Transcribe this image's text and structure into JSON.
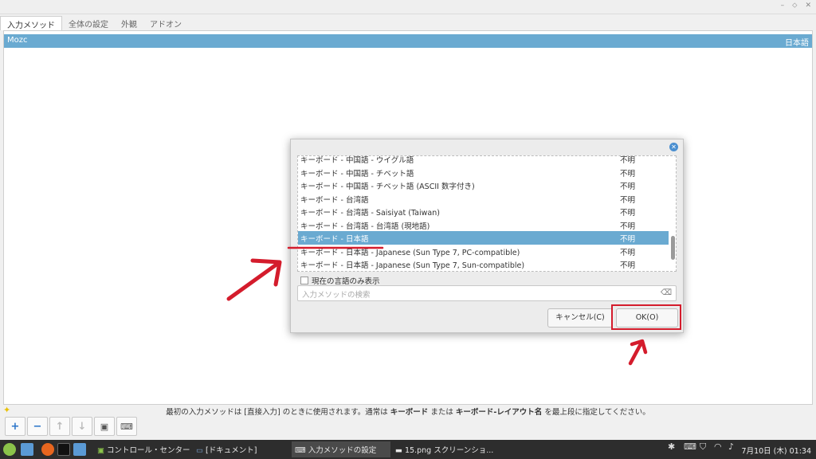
{
  "window": {
    "tabs": [
      "入力メソッド",
      "全体の設定",
      "外観",
      "アドオン"
    ],
    "im_row": {
      "name": "Mozc",
      "lang": "日本語"
    },
    "help_text": {
      "p1": "最初の入力メソッドは [直接入力] のときに使用されます。通常は ",
      "b1": "キーボード",
      "p2": " または ",
      "b2": "キーボード-レイアウト名",
      "p3": " を最上段に指定してください。"
    },
    "toolbar": [
      "add-icon",
      "remove-icon",
      "move-up-icon",
      "move-down-icon",
      "configure-icon",
      "keyboard-icon"
    ]
  },
  "dialog": {
    "items": [
      {
        "name": "キーボード - 中国語 - ウイグル語",
        "status": "不明"
      },
      {
        "name": "キーボード - 中国語 - チベット語",
        "status": "不明"
      },
      {
        "name": "キーボード - 中国語 - チベット語 (ASCII 数字付き)",
        "status": "不明"
      },
      {
        "name": "キーボード - 台湾語",
        "status": "不明"
      },
      {
        "name": "キーボード - 台湾語 - Saisiyat (Taiwan)",
        "status": "不明"
      },
      {
        "name": "キーボード - 台湾語 - 台湾語 (現地語)",
        "status": "不明"
      },
      {
        "name": "キーボード - 日本語",
        "status": "不明"
      },
      {
        "name": "キーボード - 日本語 - Japanese (Sun Type 7, PC-compatible)",
        "status": "不明"
      },
      {
        "name": "キーボード - 日本語 - Japanese (Sun Type 7, Sun-compatible)",
        "status": "不明"
      }
    ],
    "selected_index": 6,
    "current_lang_only_label": "現在の言語のみ表示",
    "search_placeholder": "入力メソッドの検索",
    "cancel_label": "キャンセル(C)",
    "ok_label": "OK(O)"
  },
  "taskbar": {
    "tasks": [
      "コントロール・センター",
      "[ドキュメント]",
      "入力メソッドの設定",
      "15.png スクリーンショ..."
    ],
    "active_task": 2,
    "clock": "7月10日 (木) 01:34"
  },
  "colors": {
    "accent": "#6aaad1",
    "annotation": "#d41c2c",
    "taskbar": "#2d2d2d"
  }
}
